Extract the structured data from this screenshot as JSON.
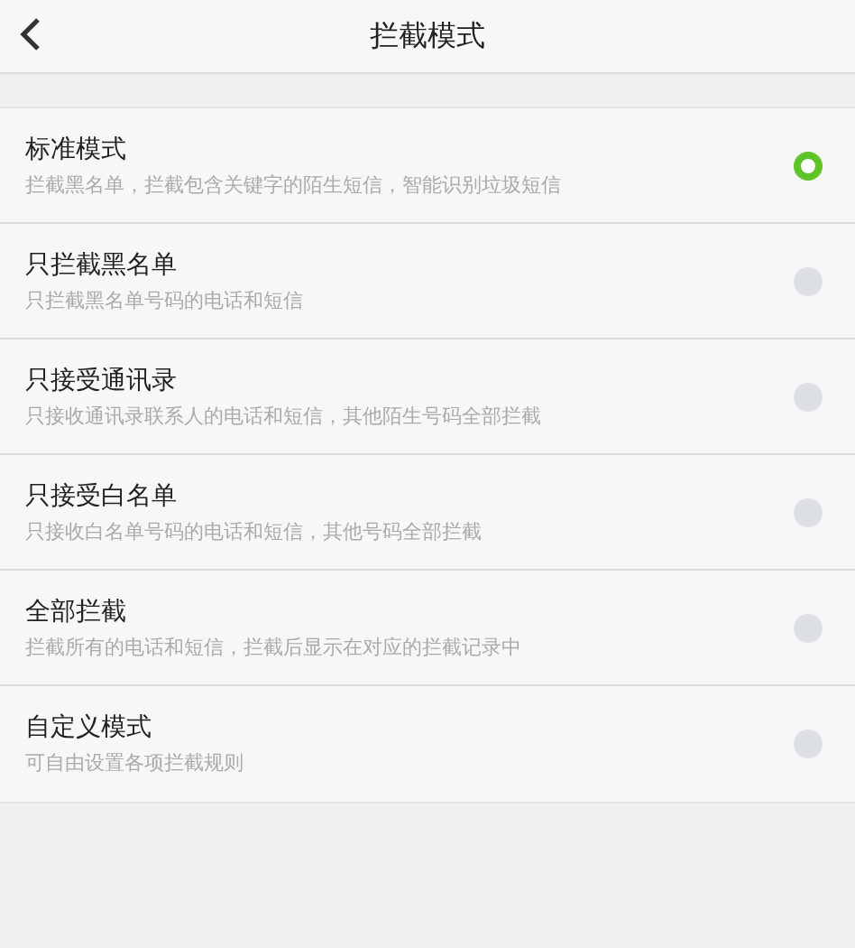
{
  "header": {
    "title": "拦截模式"
  },
  "modes": [
    {
      "title": "标准模式",
      "description": "拦截黑名单，拦截包含关键字的陌生短信，智能识别垃圾短信",
      "selected": true
    },
    {
      "title": "只拦截黑名单",
      "description": "只拦截黑名单号码的电话和短信",
      "selected": false
    },
    {
      "title": "只接受通讯录",
      "description": "只接收通讯录联系人的电话和短信，其他陌生号码全部拦截",
      "selected": false
    },
    {
      "title": "只接受白名单",
      "description": "只接收白名单号码的电话和短信，其他号码全部拦截",
      "selected": false
    },
    {
      "title": "全部拦截",
      "description": "拦截所有的电话和短信，拦截后显示在对应的拦截记录中",
      "selected": false
    },
    {
      "title": "自定义模式",
      "description": "可自由设置各项拦截规则",
      "selected": false
    }
  ]
}
